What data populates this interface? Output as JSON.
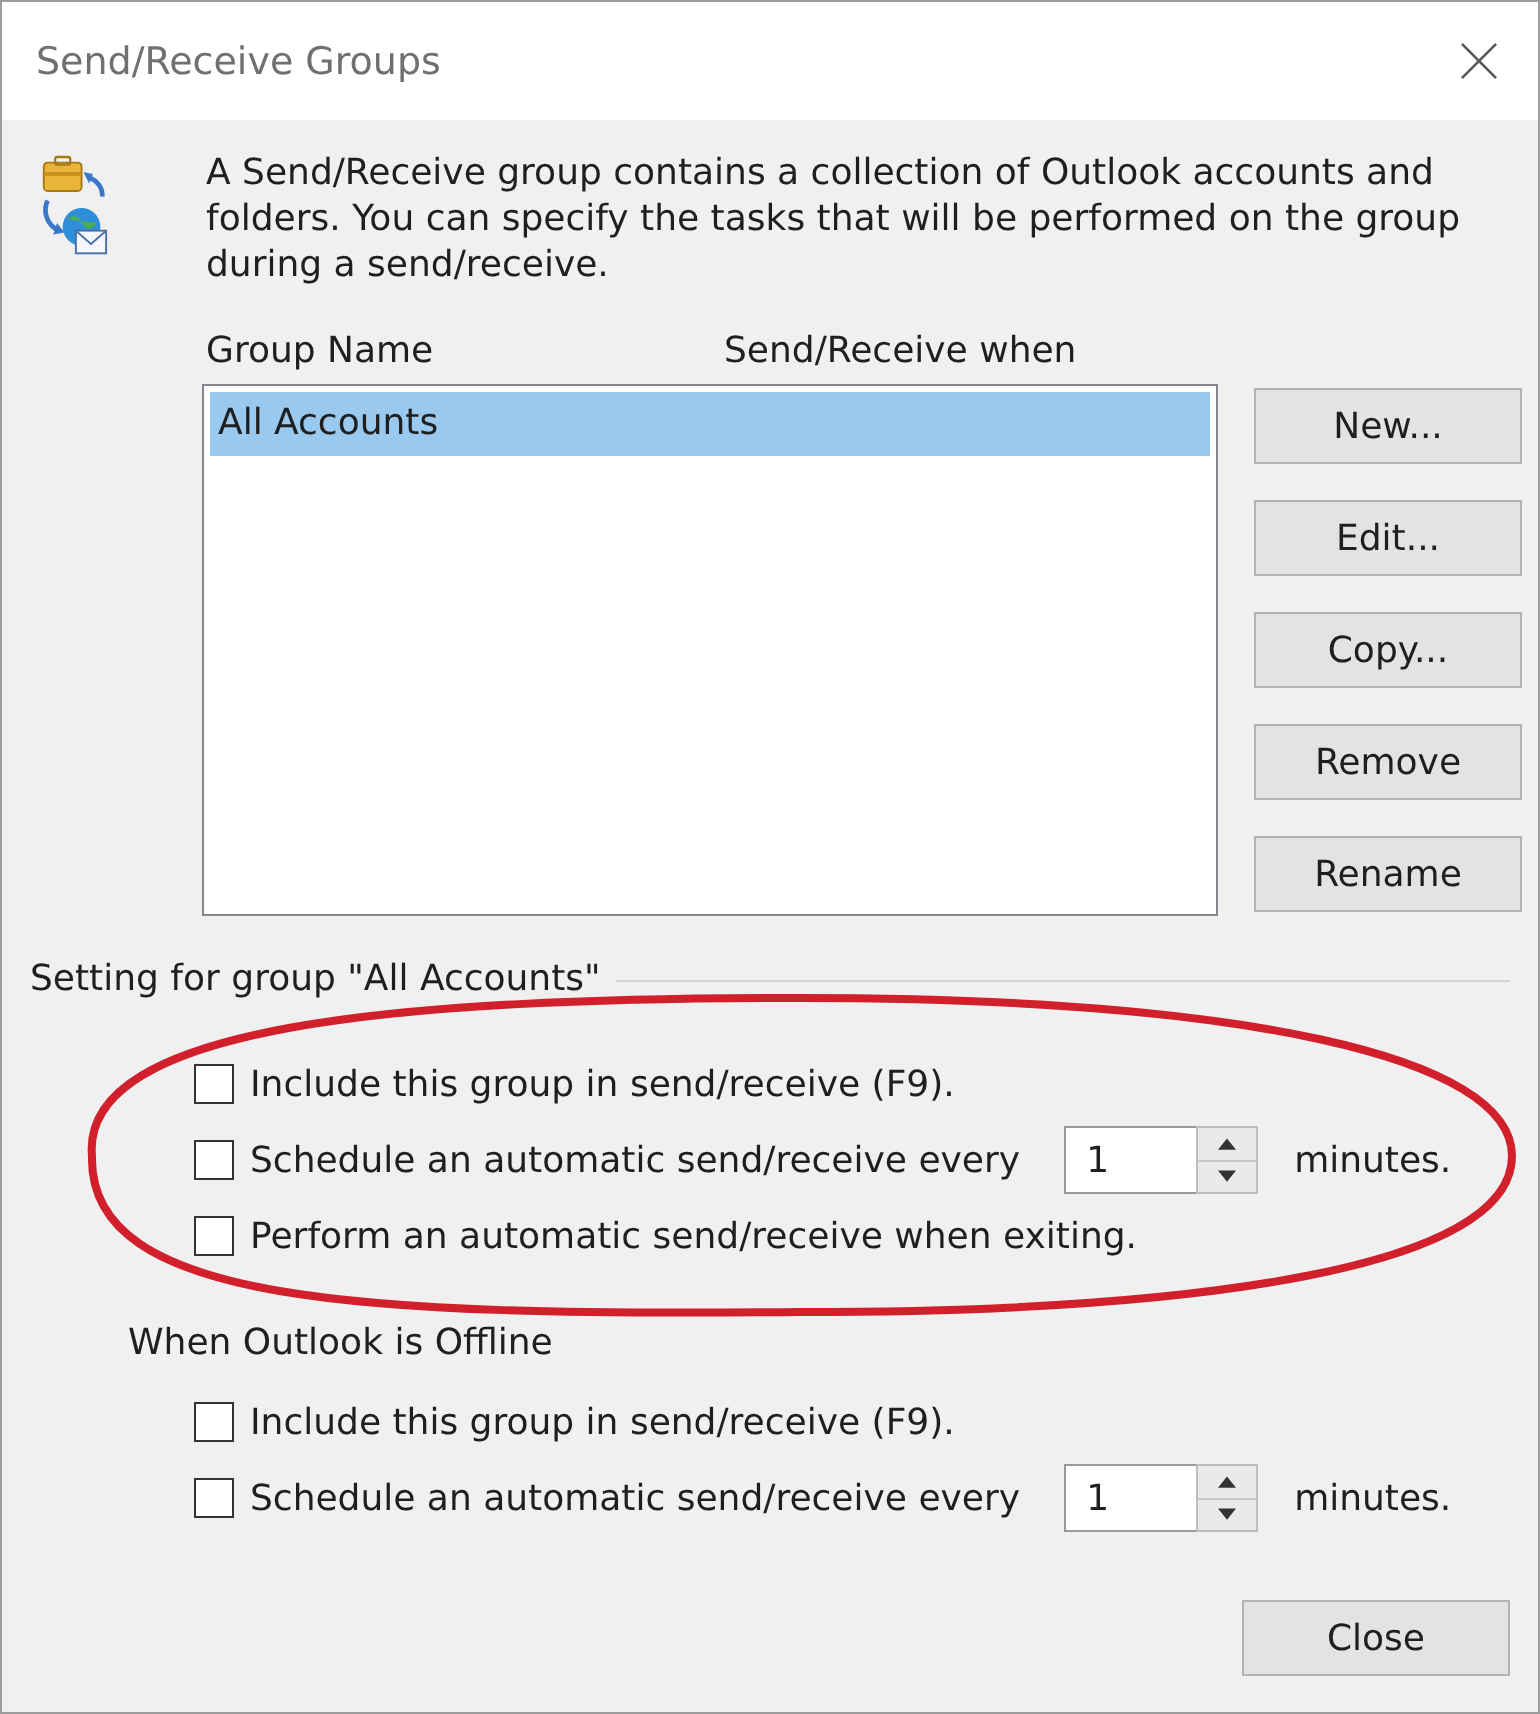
{
  "window": {
    "title": "Send/Receive Groups"
  },
  "description": "A Send/Receive group contains a collection of Outlook accounts and folders. You can specify the tasks that will be performed on the group during a send/receive.",
  "groups_list": {
    "columns": [
      "Group Name",
      "Send/Receive when"
    ],
    "rows": [
      {
        "name": "All Accounts",
        "selected": true
      }
    ]
  },
  "side_buttons": [
    "New...",
    "Edit...",
    "Copy...",
    "Remove",
    "Rename"
  ],
  "group_settings": {
    "title": "Setting for group \"All Accounts\"",
    "options": [
      {
        "kind": "checkbox",
        "label": "Include this group in send/receive (F9).",
        "checked": false
      },
      {
        "kind": "schedule",
        "label": "Schedule an automatic send/receive every",
        "checked": false,
        "value": "1",
        "unit": "minutes."
      },
      {
        "kind": "checkbox",
        "label": "Perform an automatic send/receive when exiting.",
        "checked": false
      }
    ]
  },
  "annotation": {
    "kind": "ellipse"
  },
  "offline": {
    "title": "When Outlook is Offline",
    "options": [
      {
        "kind": "checkbox",
        "label": "Include this group in send/receive (F9).",
        "checked": false
      },
      {
        "kind": "schedule",
        "label": "Schedule an automatic send/receive every",
        "checked": false,
        "value": "1",
        "unit": "minutes."
      }
    ]
  },
  "buttons": [
    "Close"
  ]
}
